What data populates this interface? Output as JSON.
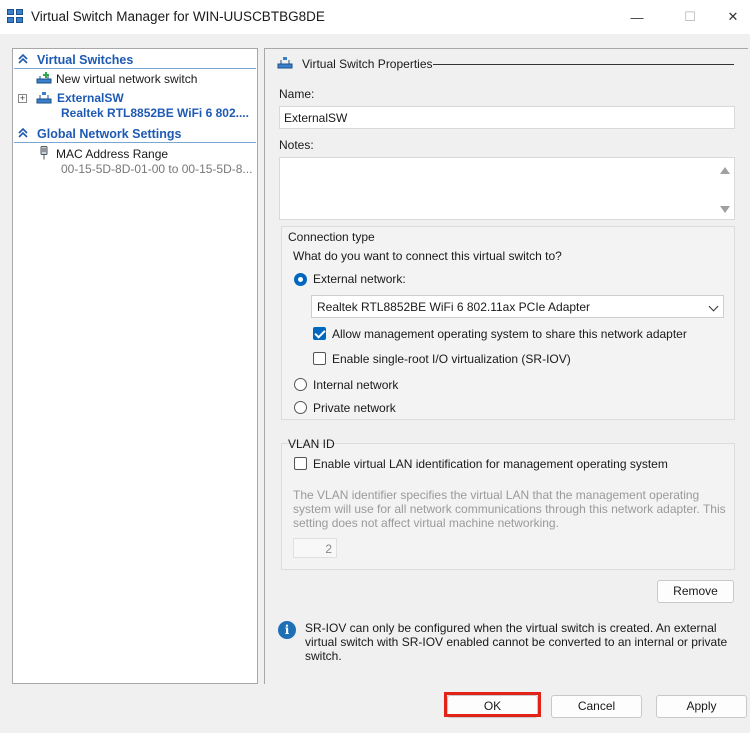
{
  "window": {
    "title": "Virtual Switch Manager for WIN-UUSCBTBG8DE",
    "minimize_glyph": "—",
    "maximize_glyph": "☐",
    "close_glyph": "✕"
  },
  "tree": {
    "virtual_switches_header": "Virtual Switches",
    "new_switch_label": "New virtual network switch",
    "switch_name": "ExternalSW",
    "switch_adapter": "Realtek RTL8852BE WiFi 6 802....",
    "global_header": "Global Network Settings",
    "mac_label": "MAC Address Range",
    "mac_range": "00-15-5D-8D-01-00 to 00-15-5D-8..."
  },
  "properties": {
    "section_title": "Virtual Switch Properties",
    "name_label": "Name:",
    "name_value": "ExternalSW",
    "notes_label": "Notes:",
    "notes_value": "",
    "connection_type_label": "Connection type",
    "connection_question": "What do you want to connect this virtual switch to?",
    "external_label": "External network:",
    "adapter_selected": "Realtek RTL8852BE WiFi 6 802.11ax PCIe Adapter",
    "allow_mgmt_label": "Allow management operating system to share this network adapter",
    "allow_mgmt_checked": true,
    "sriov_label": "Enable single-root I/O virtualization (SR-IOV)",
    "sriov_checked": false,
    "internal_label": "Internal network",
    "private_label": "Private network",
    "selected_connection": "external",
    "vlan_title": "VLAN ID",
    "vlan_enable_label": "Enable virtual LAN identification for management operating system",
    "vlan_enabled": false,
    "vlan_description": "The VLAN identifier specifies the virtual LAN that the management operating system will use for all network communications through this network adapter. This setting does not affect virtual machine networking.",
    "vlan_value": "2",
    "remove_label": "Remove",
    "info_glyph": "i",
    "info_text": "SR-IOV can only be configured when the virtual switch is created. An external virtual switch with SR-IOV enabled cannot be converted to an internal or private switch."
  },
  "footer": {
    "ok_label": "OK",
    "cancel_label": "Cancel",
    "apply_label": "Apply"
  },
  "colors": {
    "accent": "#0067c0",
    "tree_header": "#1e5ab4",
    "highlight": "#e2231a"
  }
}
